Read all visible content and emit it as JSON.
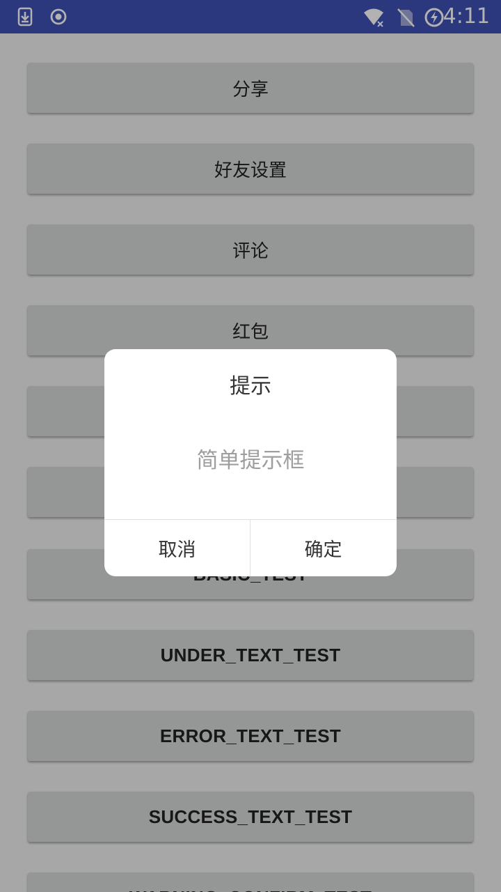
{
  "status_bar": {
    "time": "4:11",
    "left_icons": [
      "download-icon",
      "record-icon"
    ],
    "right_icons": [
      "wifi-off-icon",
      "no-sim-icon",
      "battery-charging-icon"
    ],
    "background": "#3f51b5"
  },
  "buttons": [
    {
      "label": "分享"
    },
    {
      "label": "好友设置"
    },
    {
      "label": "评论"
    },
    {
      "label": "红包"
    },
    {
      "label": ""
    },
    {
      "label": ""
    },
    {
      "label": "BASIC_TEST"
    },
    {
      "label": "UNDER_TEXT_TEST"
    },
    {
      "label": "ERROR_TEXT_TEST"
    },
    {
      "label": "SUCCESS_TEXT_TEST"
    },
    {
      "label": "WARNING_CONFIRM_TEST"
    }
  ],
  "dialog": {
    "title": "提示",
    "message": "简单提示框",
    "cancel_label": "取消",
    "confirm_label": "确定"
  },
  "colors": {
    "button_background": "#d6d7d7",
    "scrim": "rgba(0,0,0,0.30)",
    "dialog_background": "#ffffff",
    "message_color": "#9e9e9e"
  }
}
